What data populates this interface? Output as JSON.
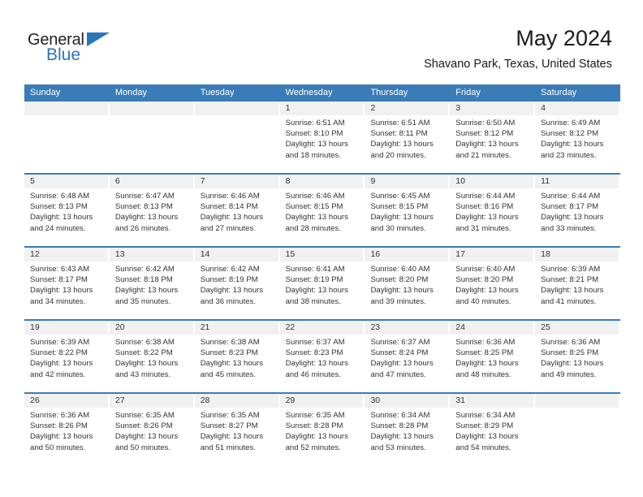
{
  "brand": {
    "name_primary": "General",
    "name_secondary": "Blue",
    "accent_color": "#2a75bb"
  },
  "header": {
    "month_title": "May 2024",
    "location": "Shavano Park, Texas, United States",
    "header_bg_color": "#3a7cb8",
    "date_strip_color": "#f1f1f1"
  },
  "calendar": {
    "weekday_headers": [
      "Sunday",
      "Monday",
      "Tuesday",
      "Wednesday",
      "Thursday",
      "Friday",
      "Saturday"
    ],
    "labels": {
      "sunrise": "Sunrise:",
      "sunset": "Sunset:",
      "daylight": "Daylight:"
    },
    "weeks": [
      [
        {
          "day": "",
          "empty": true
        },
        {
          "day": "",
          "empty": true
        },
        {
          "day": "",
          "empty": true
        },
        {
          "day": "1",
          "sunrise": "Sunrise: 6:51 AM",
          "sunset": "Sunset: 8:10 PM",
          "daylight_l1": "Daylight: 13 hours",
          "daylight_l2": "and 18 minutes."
        },
        {
          "day": "2",
          "sunrise": "Sunrise: 6:51 AM",
          "sunset": "Sunset: 8:11 PM",
          "daylight_l1": "Daylight: 13 hours",
          "daylight_l2": "and 20 minutes."
        },
        {
          "day": "3",
          "sunrise": "Sunrise: 6:50 AM",
          "sunset": "Sunset: 8:12 PM",
          "daylight_l1": "Daylight: 13 hours",
          "daylight_l2": "and 21 minutes."
        },
        {
          "day": "4",
          "sunrise": "Sunrise: 6:49 AM",
          "sunset": "Sunset: 8:12 PM",
          "daylight_l1": "Daylight: 13 hours",
          "daylight_l2": "and 23 minutes."
        }
      ],
      [
        {
          "day": "5",
          "sunrise": "Sunrise: 6:48 AM",
          "sunset": "Sunset: 8:13 PM",
          "daylight_l1": "Daylight: 13 hours",
          "daylight_l2": "and 24 minutes."
        },
        {
          "day": "6",
          "sunrise": "Sunrise: 6:47 AM",
          "sunset": "Sunset: 8:13 PM",
          "daylight_l1": "Daylight: 13 hours",
          "daylight_l2": "and 26 minutes."
        },
        {
          "day": "7",
          "sunrise": "Sunrise: 6:46 AM",
          "sunset": "Sunset: 8:14 PM",
          "daylight_l1": "Daylight: 13 hours",
          "daylight_l2": "and 27 minutes."
        },
        {
          "day": "8",
          "sunrise": "Sunrise: 6:46 AM",
          "sunset": "Sunset: 8:15 PM",
          "daylight_l1": "Daylight: 13 hours",
          "daylight_l2": "and 28 minutes."
        },
        {
          "day": "9",
          "sunrise": "Sunrise: 6:45 AM",
          "sunset": "Sunset: 8:15 PM",
          "daylight_l1": "Daylight: 13 hours",
          "daylight_l2": "and 30 minutes."
        },
        {
          "day": "10",
          "sunrise": "Sunrise: 6:44 AM",
          "sunset": "Sunset: 8:16 PM",
          "daylight_l1": "Daylight: 13 hours",
          "daylight_l2": "and 31 minutes."
        },
        {
          "day": "11",
          "sunrise": "Sunrise: 6:44 AM",
          "sunset": "Sunset: 8:17 PM",
          "daylight_l1": "Daylight: 13 hours",
          "daylight_l2": "and 33 minutes."
        }
      ],
      [
        {
          "day": "12",
          "sunrise": "Sunrise: 6:43 AM",
          "sunset": "Sunset: 8:17 PM",
          "daylight_l1": "Daylight: 13 hours",
          "daylight_l2": "and 34 minutes."
        },
        {
          "day": "13",
          "sunrise": "Sunrise: 6:42 AM",
          "sunset": "Sunset: 8:18 PM",
          "daylight_l1": "Daylight: 13 hours",
          "daylight_l2": "and 35 minutes."
        },
        {
          "day": "14",
          "sunrise": "Sunrise: 6:42 AM",
          "sunset": "Sunset: 8:19 PM",
          "daylight_l1": "Daylight: 13 hours",
          "daylight_l2": "and 36 minutes."
        },
        {
          "day": "15",
          "sunrise": "Sunrise: 6:41 AM",
          "sunset": "Sunset: 8:19 PM",
          "daylight_l1": "Daylight: 13 hours",
          "daylight_l2": "and 38 minutes."
        },
        {
          "day": "16",
          "sunrise": "Sunrise: 6:40 AM",
          "sunset": "Sunset: 8:20 PM",
          "daylight_l1": "Daylight: 13 hours",
          "daylight_l2": "and 39 minutes."
        },
        {
          "day": "17",
          "sunrise": "Sunrise: 6:40 AM",
          "sunset": "Sunset: 8:20 PM",
          "daylight_l1": "Daylight: 13 hours",
          "daylight_l2": "and 40 minutes."
        },
        {
          "day": "18",
          "sunrise": "Sunrise: 6:39 AM",
          "sunset": "Sunset: 8:21 PM",
          "daylight_l1": "Daylight: 13 hours",
          "daylight_l2": "and 41 minutes."
        }
      ],
      [
        {
          "day": "19",
          "sunrise": "Sunrise: 6:39 AM",
          "sunset": "Sunset: 8:22 PM",
          "daylight_l1": "Daylight: 13 hours",
          "daylight_l2": "and 42 minutes."
        },
        {
          "day": "20",
          "sunrise": "Sunrise: 6:38 AM",
          "sunset": "Sunset: 8:22 PM",
          "daylight_l1": "Daylight: 13 hours",
          "daylight_l2": "and 43 minutes."
        },
        {
          "day": "21",
          "sunrise": "Sunrise: 6:38 AM",
          "sunset": "Sunset: 8:23 PM",
          "daylight_l1": "Daylight: 13 hours",
          "daylight_l2": "and 45 minutes."
        },
        {
          "day": "22",
          "sunrise": "Sunrise: 6:37 AM",
          "sunset": "Sunset: 8:23 PM",
          "daylight_l1": "Daylight: 13 hours",
          "daylight_l2": "and 46 minutes."
        },
        {
          "day": "23",
          "sunrise": "Sunrise: 6:37 AM",
          "sunset": "Sunset: 8:24 PM",
          "daylight_l1": "Daylight: 13 hours",
          "daylight_l2": "and 47 minutes."
        },
        {
          "day": "24",
          "sunrise": "Sunrise: 6:36 AM",
          "sunset": "Sunset: 8:25 PM",
          "daylight_l1": "Daylight: 13 hours",
          "daylight_l2": "and 48 minutes."
        },
        {
          "day": "25",
          "sunrise": "Sunrise: 6:36 AM",
          "sunset": "Sunset: 8:25 PM",
          "daylight_l1": "Daylight: 13 hours",
          "daylight_l2": "and 49 minutes."
        }
      ],
      [
        {
          "day": "26",
          "sunrise": "Sunrise: 6:36 AM",
          "sunset": "Sunset: 8:26 PM",
          "daylight_l1": "Daylight: 13 hours",
          "daylight_l2": "and 50 minutes."
        },
        {
          "day": "27",
          "sunrise": "Sunrise: 6:35 AM",
          "sunset": "Sunset: 8:26 PM",
          "daylight_l1": "Daylight: 13 hours",
          "daylight_l2": "and 50 minutes."
        },
        {
          "day": "28",
          "sunrise": "Sunrise: 6:35 AM",
          "sunset": "Sunset: 8:27 PM",
          "daylight_l1": "Daylight: 13 hours",
          "daylight_l2": "and 51 minutes."
        },
        {
          "day": "29",
          "sunrise": "Sunrise: 6:35 AM",
          "sunset": "Sunset: 8:28 PM",
          "daylight_l1": "Daylight: 13 hours",
          "daylight_l2": "and 52 minutes."
        },
        {
          "day": "30",
          "sunrise": "Sunrise: 6:34 AM",
          "sunset": "Sunset: 8:28 PM",
          "daylight_l1": "Daylight: 13 hours",
          "daylight_l2": "and 53 minutes."
        },
        {
          "day": "31",
          "sunrise": "Sunrise: 6:34 AM",
          "sunset": "Sunset: 8:29 PM",
          "daylight_l1": "Daylight: 13 hours",
          "daylight_l2": "and 54 minutes."
        },
        {
          "day": "",
          "empty": true
        }
      ]
    ]
  }
}
